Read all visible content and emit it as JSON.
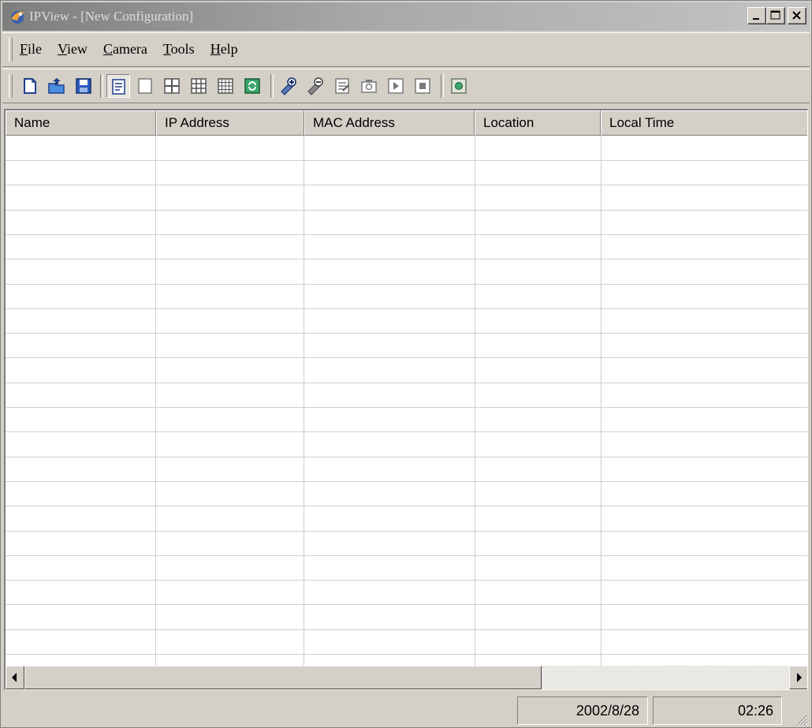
{
  "window": {
    "title": "IPView - [New Configuration]",
    "caption_buttons": [
      "minimize-icon",
      "maximize-icon",
      "close-icon"
    ]
  },
  "menu": {
    "items": [
      {
        "label": "File",
        "accel": "F",
        "rest": "ile"
      },
      {
        "label": "View",
        "accel": "V",
        "rest": "iew"
      },
      {
        "label": "Camera",
        "accel": "C",
        "rest": "amera"
      },
      {
        "label": "Tools",
        "accel": "T",
        "rest": "ools"
      },
      {
        "label": "Help",
        "accel": "H",
        "rest": "elp"
      }
    ]
  },
  "toolbar": {
    "buttons": [
      "new-file-icon",
      "open-folder-icon",
      "save-disk-icon",
      "list-view-icon",
      "single-view-icon",
      "quad-view-icon",
      "nine-view-icon",
      "sixteen-view-icon",
      "refresh-icon",
      "add-camera-icon",
      "remove-camera-icon",
      "camera-properties-icon",
      "snapshot-icon",
      "play-icon",
      "stop-icon",
      "about-icon"
    ],
    "pressed": "list-view-icon"
  },
  "table": {
    "columns": [
      "Name",
      "IP Address",
      "MAC Address",
      "Location",
      "Local Time"
    ],
    "rows": []
  },
  "status": {
    "date": "2002/8/28",
    "time": "02:26"
  },
  "colors": {
    "face": "#d4d0c8",
    "title_gradient_start": "#7e7e7e",
    "title_gradient_end": "#c4c4c4",
    "grid_line": "#cfcfcf"
  }
}
